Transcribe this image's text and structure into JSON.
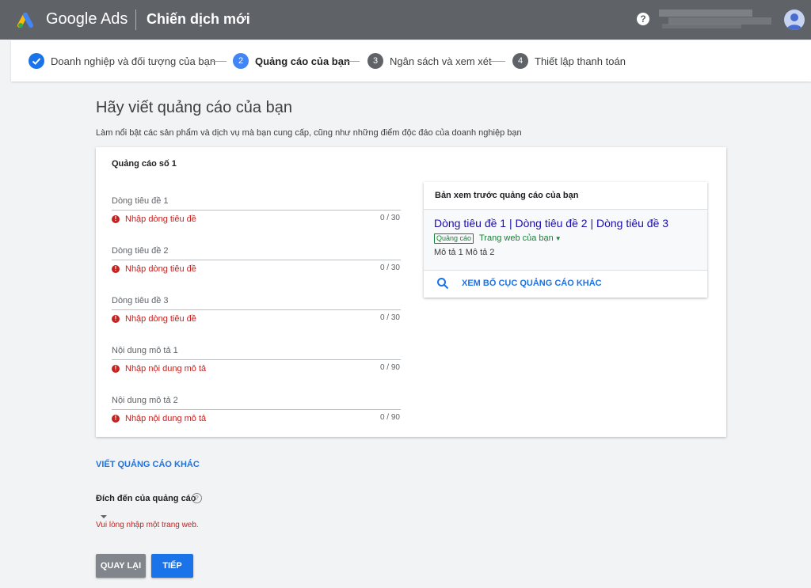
{
  "header": {
    "brand": "Google Ads",
    "page_title": "Chiến dịch mới",
    "help_glyph": "?",
    "icons": [
      "google-ads-logo-icon",
      "help-icon",
      "avatar-icon"
    ]
  },
  "stepper": {
    "steps": [
      {
        "number": "",
        "label": "Doanh nghiệp và đối tượng của bạn",
        "state": "done"
      },
      {
        "number": "2",
        "label": "Quảng cáo của bạn",
        "state": "active"
      },
      {
        "number": "3",
        "label": "Ngân sách và xem xét",
        "state": "pending"
      },
      {
        "number": "4",
        "label": "Thiết lập thanh toán",
        "state": "pending"
      }
    ]
  },
  "main": {
    "heading": "Hãy viết quảng cáo của bạn",
    "subheading": "Làm nổi bật các sản phẩm và dịch vụ mà bạn cung cấp, cũng như những điểm độc đáo của doanh nghiệp bạn"
  },
  "ad_card": {
    "title": "Quảng cáo số 1",
    "fields": [
      {
        "label": "Dòng tiêu đề 1",
        "error": "Nhập dòng tiêu đề",
        "counter": "0 / 30"
      },
      {
        "label": "Dòng tiêu đề 2",
        "error": "Nhập dòng tiêu đề",
        "counter": "0 / 30"
      },
      {
        "label": "Dòng tiêu đề 3",
        "error": "Nhập dòng tiêu đề",
        "counter": "0 / 30"
      },
      {
        "label": "Nội dung mô tả 1",
        "error": "Nhập nội dung mô tả",
        "counter": "0 / 90"
      },
      {
        "label": "Nội dung mô tả 2",
        "error": "Nhập nội dung mô tả",
        "counter": "0 / 90"
      }
    ]
  },
  "preview": {
    "title": "Bản xem trước quảng cáo của bạn",
    "headline": "Dòng tiêu đề 1 | Dòng tiêu đề 2 | Dòng tiêu đề 3",
    "badge": "Quảng cáo",
    "url": "Trang web của bạn",
    "description": "Mô tả 1 Mô tả 2",
    "link": "XEM BỐ CỤC QUẢNG CÁO KHÁC"
  },
  "write_another": "VIẾT QUẢNG CÁO KHÁC",
  "destination": {
    "label": "Đích đến của quảng cáo",
    "help_glyph": "?",
    "error": "Vui lòng nhập một trang web."
  },
  "buttons": {
    "back": "QUAY LẠI",
    "next": "TIẾP"
  },
  "colors": {
    "header_bg": "#5f6368",
    "accent_blue": "#1a73e8",
    "error_red": "#c5221f",
    "ad_green": "#188038",
    "step_pending": "#5f6368"
  }
}
